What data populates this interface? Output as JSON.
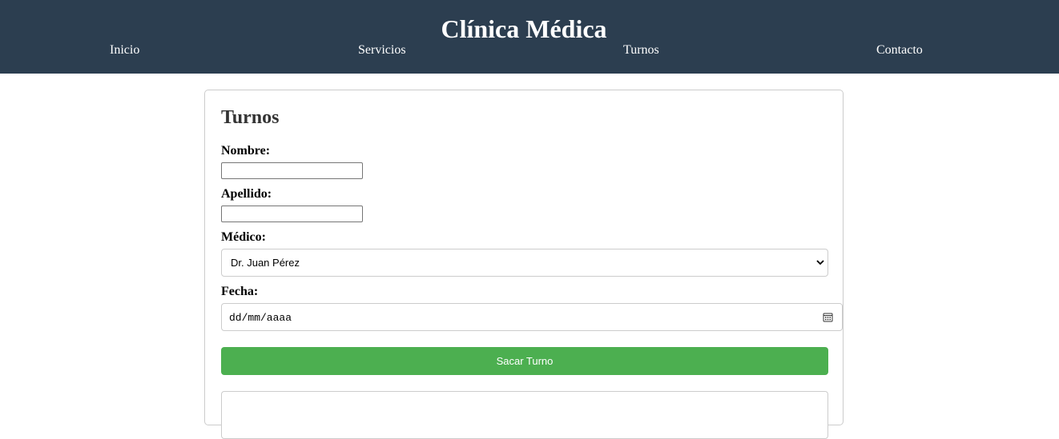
{
  "header": {
    "title": "Clínica Médica",
    "nav": [
      "Inicio",
      "Servicios",
      "Turnos",
      "Contacto"
    ],
    "background": "#2c3e50"
  },
  "form": {
    "title": "Turnos",
    "nombre_label": "Nombre:",
    "nombre_value": "",
    "apellido_label": "Apellido:",
    "apellido_value": "",
    "medico_label": "Médico:",
    "medico_selected": "Dr. Juan Pérez",
    "fecha_label": "Fecha:",
    "fecha_placeholder": "dd/mm/aaaa",
    "submit_label": "Sacar Turno",
    "submit_color": "#4caf50"
  },
  "icons": {
    "select": "chevron-down-icon",
    "date": "calendar-icon"
  }
}
